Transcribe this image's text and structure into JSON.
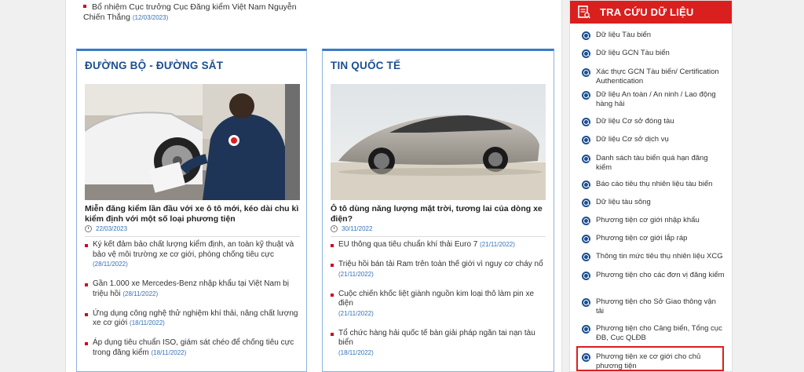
{
  "top_news": {
    "title": "Bổ nhiệm Cục trưởng Cục Đăng kiểm Việt Nam Nguyễn Chiến Thắng",
    "date": "(12/03/2023)"
  },
  "road_rail": {
    "heading": "ĐƯỜNG BỘ - ĐƯỜNG SẮT",
    "lead_title": "Miễn đăng kiểm lần đầu với xe ô tô mới, kéo dài chu kì kiểm định với một số loại phương tiện",
    "lead_date": "22/03/2023",
    "items": [
      {
        "title": "Ký kết đảm bảo chất lượng kiểm định, an toàn kỹ thuật và bảo vệ môi trường xe cơ giới, phòng chống tiêu cực",
        "date": "(28/11/2022)"
      },
      {
        "title": "Gần 1.000 xe Mercedes-Benz nhập khẩu tại Việt Nam bị triệu hồi",
        "date": "(28/11/2022)"
      },
      {
        "title": "Ứng dụng công nghệ thử nghiệm khí thải, nâng chất lượng xe cơ giới",
        "date": "(18/11/2022)"
      },
      {
        "title": "Áp dụng tiêu chuẩn ISO, giám sát chéo để chống tiêu cực trong đăng kiểm",
        "date": "(18/11/2022)"
      }
    ]
  },
  "intl": {
    "heading": "TIN QUỐC TẾ",
    "lead_title": "Ô tô dùng năng lượng mặt trời, tương lai của dòng xe điện?",
    "lead_date": "30/11/2022",
    "items": [
      {
        "title": "EU thông qua tiêu chuẩn khí thải Euro 7",
        "date": "(21/11/2022)"
      },
      {
        "title": "Triệu hồi bán tải Ram trên toàn thế giới vì nguy cơ cháy nổ",
        "date": "(21/11/2022)"
      },
      {
        "title": "Cuộc chiến khốc liệt giành nguồn kim loại thô làm pin xe điện",
        "date": "(21/11/2022)"
      },
      {
        "title": "Tổ chức hàng hải quốc tế bàn giải pháp ngăn tai nạn tàu biển",
        "date": "(18/11/2022)"
      }
    ]
  },
  "sidebar": {
    "heading": "TRA CỨU DỮ LIỆU",
    "items": [
      "Dữ liệu Tàu biển",
      "Dữ liệu GCN Tàu biển",
      "Xác thực GCN Tàu biển/ Certification Authentication",
      "Dữ liệu An toàn / An ninh / Lao động hàng hải",
      "Dữ liệu Cơ sở đóng tàu",
      "Dữ liệu Cơ sở dịch vụ",
      "Danh sách tàu biển quá hạn đăng kiểm",
      "Báo cáo tiêu thụ nhiên liệu tàu biển",
      "Dữ liệu tàu sông",
      "Phương tiện cơ giới nhập khẩu",
      "Phương tiện cơ giới lắp ráp",
      "Thông tin mức tiêu thụ nhiên liệu XCG",
      "Phương tiện cho các đơn vị đăng kiểm",
      "Phương tiện cho Sở Giao thông vận tải",
      "Phương tiện cho Cảng biển, Tổng cục ĐB, Cục QLĐB",
      "Phương tiện xe cơ giới cho chủ phương tiện"
    ]
  },
  "colors": {
    "accent_red": "#d9201f",
    "heading_blue": "#1d4f91",
    "date_blue": "#3472b6"
  }
}
